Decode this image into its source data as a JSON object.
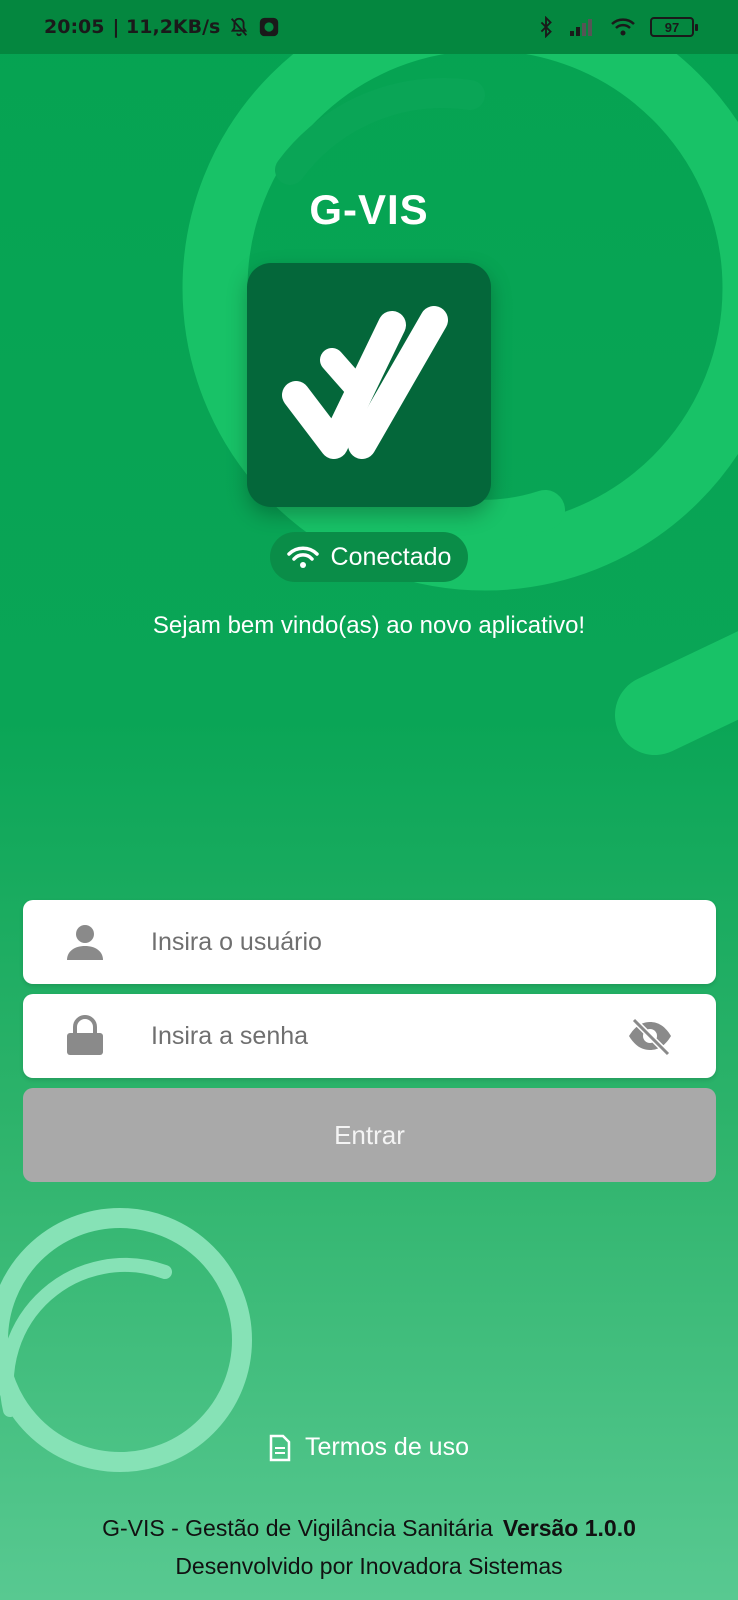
{
  "status_bar": {
    "time": "20:05",
    "network_speed": "| 11,2KB/s",
    "battery": "97",
    "icons": [
      "bell-off-icon",
      "app-icon",
      "bluetooth-icon",
      "signal-icon",
      "wifi-icon",
      "battery-icon"
    ]
  },
  "app": {
    "title": "G-VIS",
    "logo_icon": "double-check-logo-icon",
    "connection_status": "Conectado",
    "welcome": "Sejam bem vindo(as) ao novo aplicativo!"
  },
  "login": {
    "user_placeholder": "Insira o usuário",
    "password_placeholder": "Insira a senha",
    "submit_label": "Entrar"
  },
  "footer": {
    "terms_label": "Termos de uso",
    "app_fullname": "G-VIS - Gestão de Vigilância Sanitária",
    "version": "Versão 1.0.0",
    "developer": "Desenvolvido por Inovadora Sistemas"
  },
  "colors": {
    "background_top": "#05a352",
    "background_bottom": "#58c991",
    "logo_bg": "#04673a",
    "button_disabled": "#a9a9a9",
    "deco_ring": "#1cc46b"
  }
}
